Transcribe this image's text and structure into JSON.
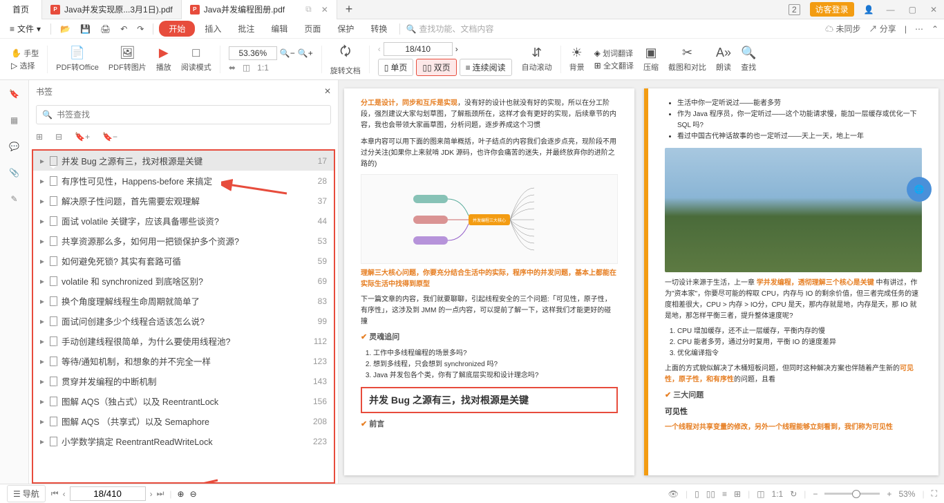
{
  "tabs": {
    "home": "首页",
    "t1": "Java并发实现原...3月1日).pdf",
    "t2": "Java并发编程图册.pdf"
  },
  "titlebar": {
    "num": "2",
    "login": "访客登录"
  },
  "menu": {
    "file": "文件",
    "start": "开始",
    "insert": "插入",
    "annotate": "批注",
    "edit": "编辑",
    "page": "页面",
    "protect": "保护",
    "convert": "转换",
    "search_ph": "查找功能、文档内容",
    "unsync": "未同步",
    "share": "分享"
  },
  "toolbar": {
    "hand": "手型",
    "select": "选择",
    "to_office": "PDF转Office",
    "to_image": "PDF转图片",
    "play": "播放",
    "read_mode": "阅读模式",
    "zoom": "53.36%",
    "rotate": "旋转文档",
    "single": "单页",
    "double": "双页",
    "continuous": "连续阅读",
    "auto_scroll": "自动滚动",
    "page_current": "18/410",
    "bg": "背景",
    "word_trans": "划词翻译",
    "full_trans": "全文翻译",
    "compress": "压缩",
    "screenshot": "截图和对比",
    "read_aloud": "朗读",
    "find": "查找"
  },
  "bookmarks": {
    "title": "书签",
    "search_ph": "书签查找",
    "items": [
      {
        "title": "并发 Bug 之源有三，找对根源是关键",
        "page": 17,
        "selected": true
      },
      {
        "title": "有序性可见性，Happens-before 来搞定",
        "page": 28
      },
      {
        "title": "解决原子性问题，首先需要宏观理解",
        "page": 37
      },
      {
        "title": "面试 volatile 关键字，应该具备哪些谈资?",
        "page": 44
      },
      {
        "title": "共享资源那么多，如何用一把锁保护多个资源?",
        "page": 53
      },
      {
        "title": "如何避免死锁? 其实有套路可循",
        "page": 59
      },
      {
        "title": "volatile 和 synchronized 到底啥区别?",
        "page": 69
      },
      {
        "title": "换个角度理解线程生命周期就简单了",
        "page": 83
      },
      {
        "title": "面试问创建多少个线程合适该怎么说?",
        "page": 99
      },
      {
        "title": "手动创建线程很简单，为什么要使用线程池?",
        "page": 112
      },
      {
        "title": "等待/通知机制，和想象的并不完全一样",
        "page": 123
      },
      {
        "title": "贯穿并发编程的中断机制",
        "page": 143
      },
      {
        "title": "图解 AQS（独占式）以及 ReentrantLock",
        "page": 156
      },
      {
        "title": "图解 AQS （共享式）以及 Semaphore",
        "page": 208
      },
      {
        "title": "小学数学搞定 ReentrantReadWriteLock",
        "page": 223
      }
    ]
  },
  "page_left": {
    "p1a": "分工是设计，同步和互斥是实现",
    "p1b": "，没有好的设计也就没有好的实现，所以在分工阶段，强烈建议大家勾划草图，了解瓶颈所在，这样才会有更好的实现，后续章节的内容，我也会带领大家画草图，分析问题，逐步养成这个习惯",
    "p2": "本章内容可以用下面的图来简单概括，叶子结点的内容我们会逐步点亮，现阶段不用过分关注(如果你上来就啃 JDK 源码，也许你会痛苦的迷失，并最终放弃你的进阶之路的)",
    "p3a": "理解三大核心问题，你要充分结合生活中的实际，程序中的并发问题，基本上都能在实际生活中找得到原型",
    "p4": "下一篇文章的内容，我们就要聊聊，引起线程安全的三个问题:「可见性，原子性，有序性」，这涉及到 JMM 的一点内容，可以提前了解一下，这样我们才能更好的碰撞",
    "h1": "灵魂追问",
    "q1": "工作中多线程编程的场景多吗?",
    "q2": "想到多线程，只会想到 synchronized 吗?",
    "q3": "Java 并发包各个类，你有了解底层实现和设计理念吗?",
    "title_box": "并发 Bug 之源有三，找对根源是关键",
    "h2": "前言"
  },
  "page_right": {
    "b1": "生活中你一定听说过——能者多劳",
    "b2": "作为 Java 程序员，你一定听过——这个功能请求慢，能加一层缓存或优化一下 SQL 吗?",
    "b3": "看过中国古代神话故事的也一定听过——天上一天，地上一年",
    "p1a": "一切设计来源于生活，上一章 ",
    "p1link": "学并发编程，透彻理解三个核心是关键",
    "p1b": " 中有讲过，作为\"资本家\"，你要尽可能的榨取 CPU，内存与 IO 的剩余价值，但三者完成任务的速度相差很大，CPU > 内存 > IO分，CPU 是天，那内存就是地，内存是天，那 IO 就是地，那怎样平衡三者，提升整体速度呢?",
    "l1": "CPU 增加缓存，还不止一层缓存，平衡内存的慢",
    "l2": "CPU 能者多劳，通过分时复用，平衡 IO 的速度差异",
    "l3": "优化编译指令",
    "p2a": "上面的方式貌似解决了木桶短板问题，但同时这种解决方案也伴随着产生新的",
    "p2b": "可见性，原子性，和有序性",
    "p2c": "的问题，且看",
    "h1": "三大问题",
    "h2": "可见性",
    "p3a": "一个线程对共享变量的修改，另外一个线程能够立刻看到，我们称为可见性"
  },
  "status": {
    "nav": "导航",
    "page": "18/410",
    "zoom": "53%"
  }
}
